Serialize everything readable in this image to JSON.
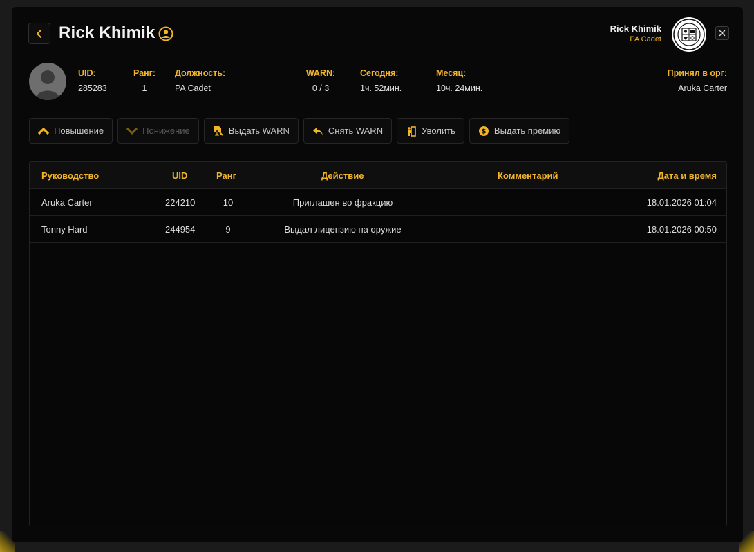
{
  "header": {
    "player_name": "Rick Khimik",
    "top_right_name": "Rick Khimik",
    "top_right_rank": "PA Cadet"
  },
  "info": {
    "uid_label": "UID:",
    "uid_value": "285283",
    "rank_label": "Ранг:",
    "rank_value": "1",
    "position_label": "Должность:",
    "position_value": "PA Cadet",
    "warn_label": "WARN:",
    "warn_value": "0 / 3",
    "today_label": "Сегодня:",
    "today_value": "1ч. 52мин.",
    "month_label": "Месяц:",
    "month_value": "10ч. 24мин.",
    "accepted_label": "Принял в орг:",
    "accepted_value": "Aruka Carter"
  },
  "actions": {
    "promote": "Повышение",
    "demote": "Понижение",
    "give_warn": "Выдать WARN",
    "remove_warn": "Снять WARN",
    "fire": "Уволить",
    "bonus": "Выдать премию"
  },
  "table": {
    "headers": {
      "leader": "Руководство",
      "uid": "UID",
      "rank": "Ранг",
      "action": "Действие",
      "comment": "Комментарий",
      "datetime": "Дата и время"
    },
    "rows": [
      {
        "leader": "Aruka Carter",
        "uid": "224210",
        "rank": "10",
        "action": "Приглашен во фракцию",
        "comment": "",
        "datetime": "18.01.2026 01:04"
      },
      {
        "leader": "Tonny Hard",
        "uid": "244954",
        "rank": "9",
        "action": "Выдал лицензию на оружие",
        "comment": "",
        "datetime": "18.01.2026 00:50"
      }
    ]
  },
  "colors": {
    "accent": "#f2b52a",
    "background": "#080808",
    "outer": "#1b1b1b"
  },
  "icons": {
    "back": "chevron-left-icon",
    "name_badge": "user-badge-icon",
    "close": "close-icon",
    "emblem": "city-seal-icon",
    "promote": "chevron-up-icon",
    "demote": "chevron-down-icon",
    "give_warn": "warn-document-icon",
    "remove_warn": "undo-arrow-icon",
    "fire": "exit-person-icon",
    "bonus": "coin-icon"
  }
}
